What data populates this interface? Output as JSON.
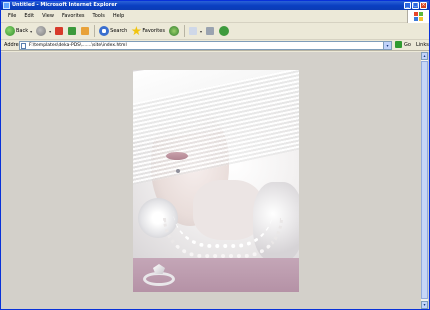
{
  "window": {
    "title": "Untitled - Microsoft Internet Explorer",
    "controls": [
      "_",
      "□",
      "×"
    ]
  },
  "menubar": {
    "items": [
      "File",
      "Edit",
      "View",
      "Favorites",
      "Tools",
      "Help"
    ]
  },
  "toolbar": {
    "back_label": "Back",
    "search_label": "Search",
    "favorites_label": "Favorites",
    "dropdown_glyph": "▾"
  },
  "addressbar": {
    "label": "Address",
    "url": "F:\\templates\\deka-PDS\\.......\\site\\index.html",
    "dropdown_glyph": "▾",
    "go_label": "Go",
    "links_label": "Links"
  },
  "scrollbar": {
    "up_glyph": "▴",
    "down_glyph": "▾"
  },
  "colors": {
    "titlebar": "#0a3fc2",
    "chrome": "#ece9d8",
    "content_bg": "#d3d0ca",
    "ring_band": "#b592a6"
  }
}
